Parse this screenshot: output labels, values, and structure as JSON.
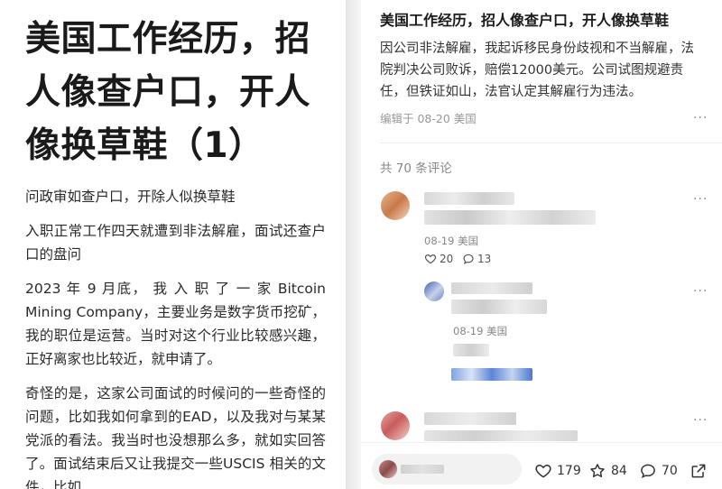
{
  "article": {
    "title": "美国工作经历，招人像查户口，开人像换草鞋（1）",
    "paragraphs": [
      "问政审如查户口，开除人似换草鞋",
      "入职正常工作四天就遭到非法解雇，面试还查户口的盘问",
      "2023 年 9 月底， 我 入 职 了 一 家 Bitcoin Mining Company，主要业务是数字货币挖矿，我的职位是运营。当时对这个行业比较感兴趣，正好离家也比较近，就申请了。",
      "奇怪的是，这家公司面试的时候问的一些奇怪的问题，比如我如何拿到的EAD，以及我对与某某党派的看法。我当时也没想那么多，就如实回答了。面试结束后又让我提交一些USCIS 相关的文件，比如"
    ]
  },
  "post": {
    "title": "美国工作经历，招人像查户口，开人像换草鞋",
    "body": "因公司非法解雇，我起诉移民身份歧视和不当解雇，法院判决公司败诉，赔偿12000美元。公司试图规避责任，但铁证如山，法官认定其解雇行为违法。",
    "meta": "编辑于 08-20 美国",
    "more": "···"
  },
  "comments": {
    "total_label": "共 70 条评论",
    "items": [
      {
        "meta": "08-19 美国",
        "likes": "20",
        "replies": "13",
        "more": "···"
      },
      {
        "meta": "08-19 美国",
        "more": "···"
      },
      {
        "more": "···"
      }
    ]
  },
  "bottom_bar": {
    "likes": "179",
    "stars": "84",
    "comments": "70"
  },
  "colors": {
    "accent_blue": "#3b6fd8",
    "text_main": "#1a1a1a",
    "text_muted": "#888888"
  }
}
